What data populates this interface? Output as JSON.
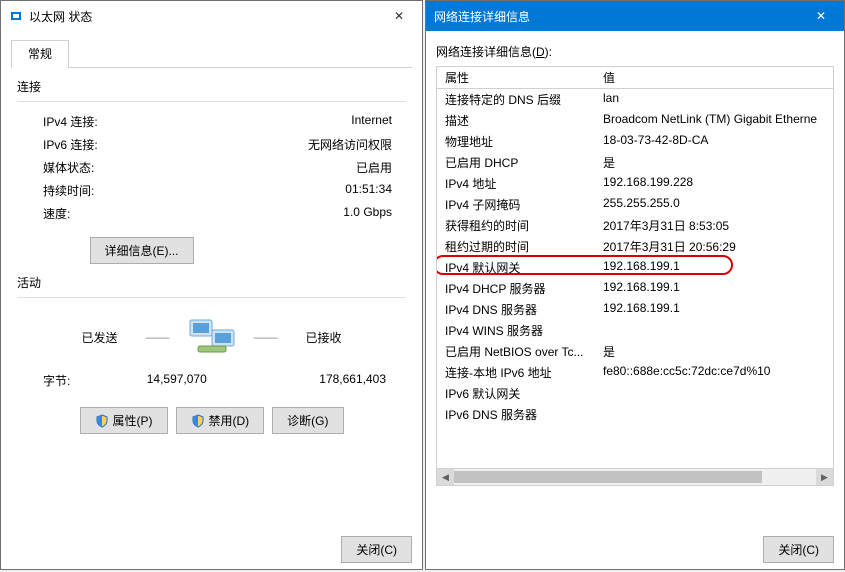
{
  "left": {
    "title": "以太网 状态",
    "tab_general": "常规",
    "sec_connection": "连接",
    "rows": {
      "ipv4_label": "IPv4 连接:",
      "ipv4_val": "Internet",
      "ipv6_label": "IPv6 连接:",
      "ipv6_val": "无网络访问权限",
      "media_label": "媒体状态:",
      "media_val": "已启用",
      "dur_label": "持续时间:",
      "dur_val": "01:51:34",
      "speed_label": "速度:",
      "speed_val": "1.0 Gbps"
    },
    "details_btn": "详细信息(E)...",
    "sec_activity": "活动",
    "sent_label": "已发送",
    "recv_label": "已接收",
    "bytes_label": "字节:",
    "bytes_sent": "14,597,070",
    "bytes_recv": "178,661,403",
    "btn_props": "属性(P)",
    "btn_disable": "禁用(D)",
    "btn_diag": "诊断(G)",
    "btn_close": "关闭(C)"
  },
  "right": {
    "title": "网络连接详细信息",
    "caption_pre": "网络连接详细信息(",
    "caption_u": "D",
    "caption_post": "):",
    "col_prop": "属性",
    "col_val": "值",
    "rows": [
      {
        "p": "连接特定的 DNS 后缀",
        "v": "lan"
      },
      {
        "p": "描述",
        "v": "Broadcom NetLink (TM) Gigabit Etherne"
      },
      {
        "p": "物理地址",
        "v": "18-03-73-42-8D-CA"
      },
      {
        "p": "已启用 DHCP",
        "v": "是"
      },
      {
        "p": "IPv4 地址",
        "v": "192.168.199.228"
      },
      {
        "p": "IPv4 子网掩码",
        "v": "255.255.255.0"
      },
      {
        "p": "获得租约的时间",
        "v": "2017年3月31日 8:53:05"
      },
      {
        "p": "租约过期的时间",
        "v": "2017年3月31日 20:56:29"
      },
      {
        "p": "IPv4 默认网关",
        "v": "192.168.199.1",
        "hl": true
      },
      {
        "p": "IPv4 DHCP 服务器",
        "v": "192.168.199.1"
      },
      {
        "p": "IPv4 DNS 服务器",
        "v": "192.168.199.1"
      },
      {
        "p": "IPv4 WINS 服务器",
        "v": ""
      },
      {
        "p": "已启用 NetBIOS over Tc...",
        "v": "是"
      },
      {
        "p": "连接-本地 IPv6 地址",
        "v": "fe80::688e:cc5c:72dc:ce7d%10"
      },
      {
        "p": "IPv6 默认网关",
        "v": ""
      },
      {
        "p": "IPv6 DNS 服务器",
        "v": ""
      }
    ],
    "btn_close": "关闭(C)"
  }
}
